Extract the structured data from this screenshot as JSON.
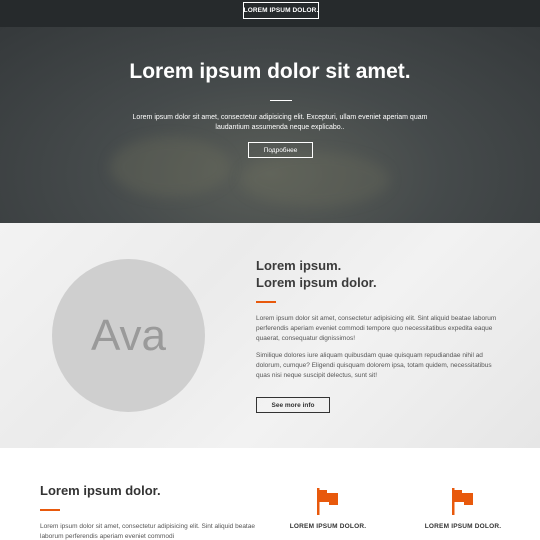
{
  "header": {
    "logo_text": "LOREM IPSUM DOLOR."
  },
  "hero": {
    "title": "Lorem ipsum dolor sit amet.",
    "text": "Lorem ipsum dolor sit amet, consectetur adipisicing elit. Excepturi, ullam eveniet aperiam quam laudantium assumenda neque explicabo..",
    "button_label": "Подробнее"
  },
  "about": {
    "avatar_text": "Ava",
    "title_line1": "Lorem ipsum.",
    "title_line2": "Lorem ipsum dolor.",
    "paragraph1": "Lorem ipsum dolor sit amet, consectetur adipisicing elit. Sint aliquid beatae laborum perferendis aperiam eveniet commodi tempore quo necessitatibus expedita eaque quaerat, consequatur dignissimos!",
    "paragraph2": "Similique dolores iure aliquam quibusdam quae quisquam repudiandae nihil ad dolorum, cumque? Eligendi quisquam dolorem ipsa, totam quidem, necessitatibus quas nisi neque suscipit delectus, sunt sit!",
    "button_label": "See more info"
  },
  "services": {
    "title": "Lorem ipsum dolor.",
    "text": "Lorem ipsum dolor sit amet, consectetur adipisicing elit. Sint aliquid beatae laborum perferendis aperiam eveniet commodi",
    "features": [
      {
        "label": "LOREM IPSUM DOLOR.",
        "icon": "flag-icon"
      },
      {
        "label": "LOREM IPSUM DOLOR.",
        "icon": "flag-icon"
      }
    ]
  },
  "colors": {
    "accent": "#e8590c",
    "header_bg": "#262a2c",
    "hero_overlay": "#3f4445"
  }
}
